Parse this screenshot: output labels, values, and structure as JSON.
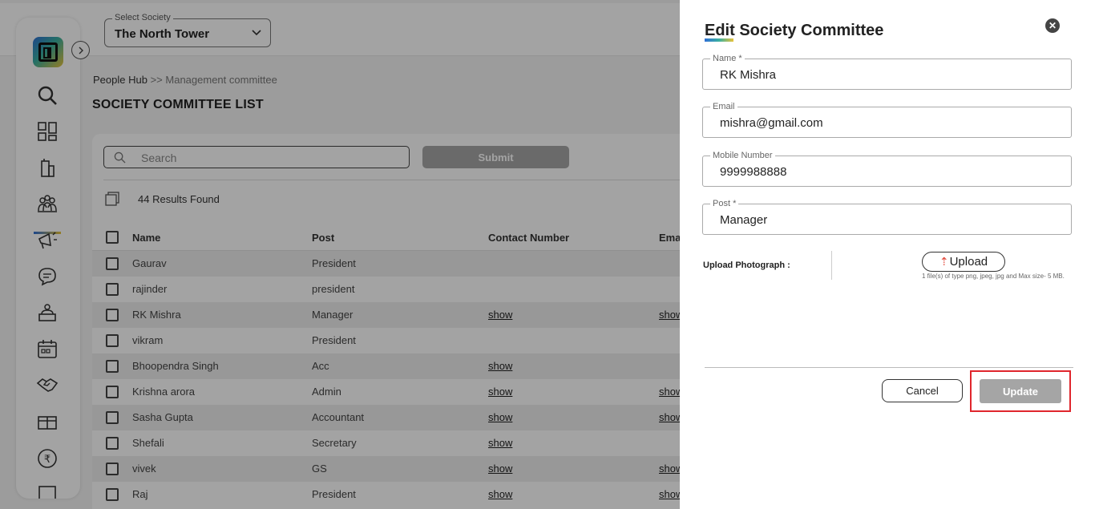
{
  "header": {
    "society_select_label": "Select Society",
    "society_select_value": "The North Tower"
  },
  "breadcrumb": {
    "root": "People Hub",
    "separator": ">>",
    "current": "Management committee"
  },
  "page_title": "SOCIETY COMMITTEE LIST",
  "search": {
    "placeholder": "Search",
    "submit_label": "Submit"
  },
  "results_text": "44 Results Found",
  "table": {
    "columns": [
      "Name",
      "Post",
      "Contact Number",
      "Ema"
    ],
    "rows": [
      {
        "name": "Gaurav",
        "post": "President",
        "contact": "",
        "email": ""
      },
      {
        "name": "rajinder",
        "post": "president",
        "contact": "",
        "email": ""
      },
      {
        "name": "RK Mishra",
        "post": "Manager",
        "contact": "show",
        "email": "show"
      },
      {
        "name": "vikram",
        "post": "President",
        "contact": "",
        "email": ""
      },
      {
        "name": "Bhoopendra Singh",
        "post": "Acc",
        "contact": "show",
        "email": ""
      },
      {
        "name": "Krishna arora",
        "post": "Admin",
        "contact": "show",
        "email": "show"
      },
      {
        "name": "Sasha Gupta",
        "post": "Accountant",
        "contact": "show",
        "email": "show"
      },
      {
        "name": "Shefali",
        "post": "Secretary",
        "contact": "show",
        "email": ""
      },
      {
        "name": "vivek",
        "post": "GS",
        "contact": "show",
        "email": "show"
      },
      {
        "name": "Raj",
        "post": "President",
        "contact": "show",
        "email": "show"
      }
    ]
  },
  "sidebar": {
    "icons": [
      "search-icon",
      "dashboard-icon",
      "building-icon",
      "people-icon",
      "megaphone-icon",
      "chat-icon",
      "service-icon",
      "calendar-icon",
      "handshake-icon",
      "parcel-icon",
      "rupee-icon",
      "more-icon"
    ],
    "active": "people-icon"
  },
  "drawer": {
    "title": "Edit Society Committee",
    "fields": {
      "name": {
        "label": "Name *",
        "value": "RK Mishra"
      },
      "email": {
        "label": "Email",
        "value": "mishra@gmail.com"
      },
      "mobile": {
        "label": "Mobile Number",
        "value": "9999988888"
      },
      "post": {
        "label": "Post *",
        "value": "Manager"
      }
    },
    "upload_label": "Upload Photograph :",
    "upload_button": "Upload",
    "upload_hint": "1 file(s) of type png, jpeg, jpg and Max size- 5 MB.",
    "cancel_label": "Cancel",
    "update_label": "Update"
  },
  "colors": {
    "accent_gradient": [
      "#2f6fd6",
      "#3ab0a0",
      "#e8c33a"
    ],
    "highlight_border": "#e0262d",
    "disabled_button": "#a5a5a5"
  }
}
